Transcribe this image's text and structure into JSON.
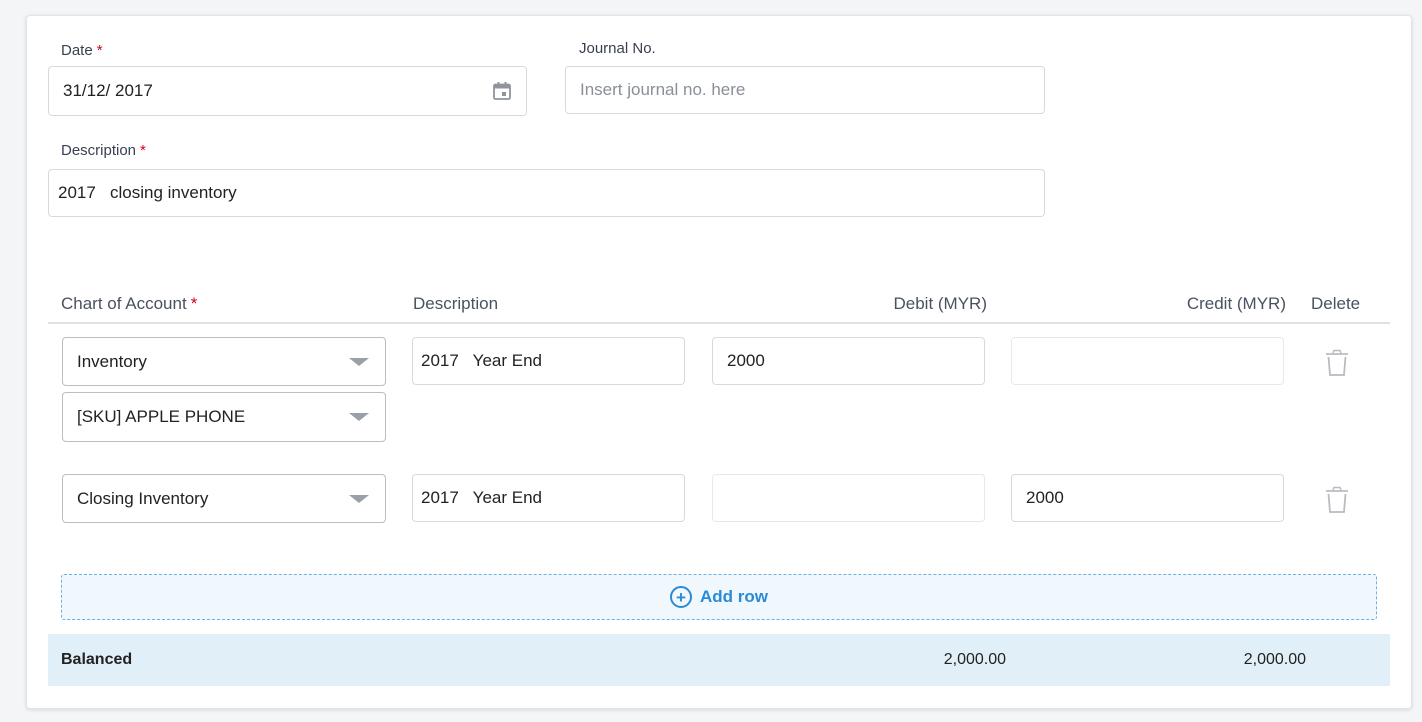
{
  "form": {
    "date": {
      "label": "Date",
      "value": "31/12/ 2017"
    },
    "journal_no": {
      "label": "Journal No.",
      "placeholder": "Insert journal no. here"
    },
    "description": {
      "label": "Description",
      "value": "2017   closing inventory"
    },
    "required_mark": "*"
  },
  "table": {
    "headers": {
      "account": "Chart of Account",
      "description": "Description",
      "debit": "Debit (MYR)",
      "credit": "Credit (MYR)",
      "delete": "Delete"
    },
    "rows": [
      {
        "account": "Inventory",
        "sub_account": "[SKU] APPLE PHONE",
        "description": "2017   Year End",
        "debit": "2000",
        "credit": ""
      },
      {
        "account": "Closing Inventory",
        "description": "2017   Year End",
        "debit": "",
        "credit": "2000"
      }
    ],
    "add_row_label": "Add row",
    "summary": {
      "status": "Balanced",
      "debit_total": "2,000.00",
      "credit_total": "2,000.00"
    }
  },
  "icons": {
    "calendar": "calendar-icon",
    "dropdown": "chevron-down-icon",
    "delete": "trash-icon",
    "add": "plus-circle-icon"
  },
  "colors": {
    "accent": "#2a8ad6",
    "required": "#d0021b",
    "summary_bg": "#e1f0f8"
  }
}
